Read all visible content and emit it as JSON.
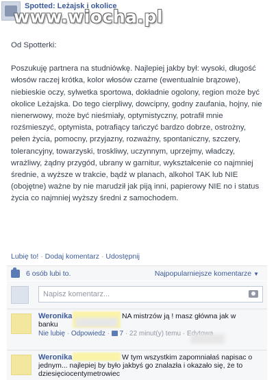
{
  "header": {
    "page_name": "Spotted: Leżajsk i okolice",
    "watermark": "www.wiocha.pl"
  },
  "post": {
    "greeting": "Od Spotterki:",
    "text": "Poszukuję partnera na studniówkę. Najlepiej jakby był: wysoki, długość włosów raczej krótka, kolor włosów czarne (ewentualnie brązowe), niebieskie oczy, sylwetka sportowa, dokładnie ogolony, region może być okolice Leżajska. Do tego cierpliwy, dowcipny, godny zaufania, hojny, nie nienerwowy, może być nieśmiały, optymistyczny, potrafił mnie rozśmieszyć, optymista, potrafiący tańczyć bardzo dobrze, ostrożny, pełen życia, pomocny, przyjazny, rozważny, spontaniczny, szczery, tolerancyjny, towarzyski, troskliwy, uczynnym, uprzejmy, władczy, wrażliwy, żądny przygód, ubrany w garnitur, wykształcenie co najmniej średnie, a wyższe w trakcie, bądź w planach, alkohol TAK lub NIE (obojętne) ważne by nie marudził jak piją inni, papierowy NIE no i status życia co najmniej wyższy średni z samochodem."
  },
  "actions": {
    "like": "Lubię to!",
    "comment": "Dodaj komentarz",
    "share": "Udostępnij",
    "separator": "·"
  },
  "likes": {
    "text": "6 osób lubi to.",
    "sort": "Najpopularniejsze komentarze",
    "sort_arrow": "▼"
  },
  "composer": {
    "placeholder": "Napisz komentarz..."
  },
  "comments": [
    {
      "author": "Weronika",
      "text_line1": "NA mistrzów ją ! masz główna jak w",
      "text_line2": "banku",
      "unlike": "Nie lubię",
      "reply": "Odpowiedz",
      "like_count": "7",
      "time": "22 minut(y) temu",
      "edited": "Edytowa"
    },
    {
      "author": "Weronika",
      "text_line1": "W tym wszystkim zapomniałaś napisac o",
      "text_line2": "jednym... najlepiej by było jakbyś go znalazła i okazało się, że to",
      "text_line3": "dziesięciocentymetrowiec"
    }
  ],
  "colors": {
    "link": "#3b5998",
    "body_text": "#37404e",
    "panel_bg": "#f6f7f9"
  }
}
